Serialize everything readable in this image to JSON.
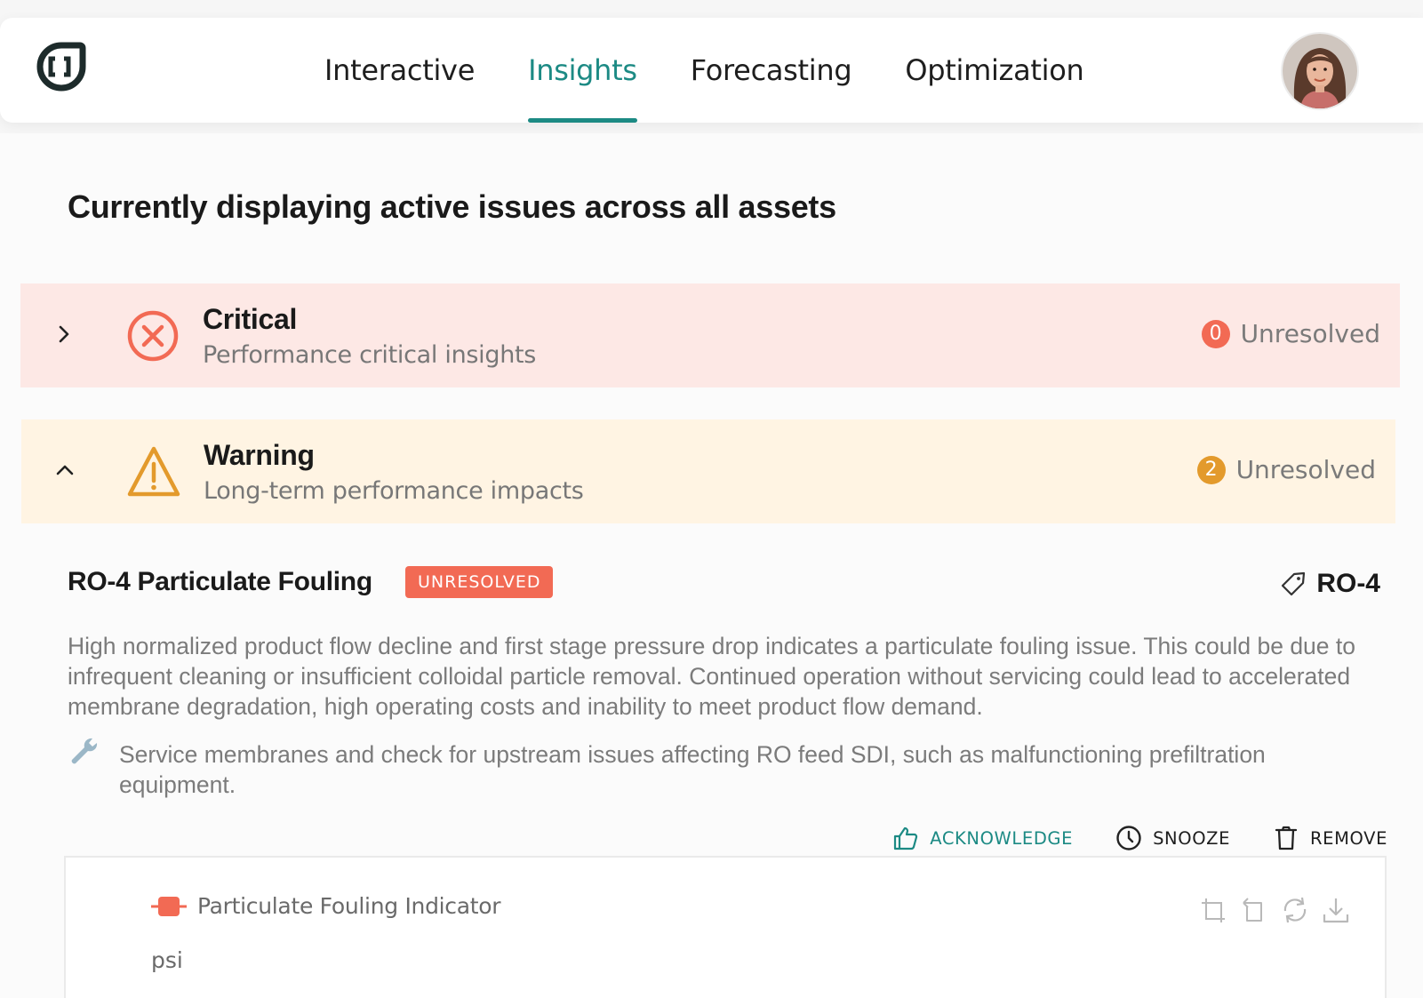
{
  "nav": {
    "items": [
      {
        "label": "Interactive",
        "active": false
      },
      {
        "label": "Insights",
        "active": true
      },
      {
        "label": "Forecasting",
        "active": false
      },
      {
        "label": "Optimization",
        "active": false
      }
    ]
  },
  "page": {
    "title": "Currently displaying active issues across all assets"
  },
  "severities": {
    "critical": {
      "title": "Critical",
      "subtitle": "Performance critical insights",
      "count": "0",
      "count_label": "Unresolved",
      "expanded": false
    },
    "warning": {
      "title": "Warning",
      "subtitle": "Long-term performance impacts",
      "count": "2",
      "count_label": "Unresolved",
      "expanded": true
    }
  },
  "issue": {
    "title": "RO-4 Particulate Fouling",
    "status": "UNRESOLVED",
    "asset": "RO-4",
    "description": "High normalized product flow decline and first stage pressure drop indicates a particulate fouling issue. This could be due to infrequent cleaning or insufficient colloidal particle removal. Continued operation without servicing could lead to accelerated membrane degradation, high operating costs and inability to meet product flow demand.",
    "recommendation": "Service membranes and check for upstream issues affecting RO feed SDI, such as malfunctioning prefiltration equipment.",
    "actions": {
      "acknowledge": "ACKNOWLEDGE",
      "snooze": "SNOOZE",
      "remove": "REMOVE"
    }
  },
  "chart": {
    "legend_label": "Particulate Fouling Indicator",
    "unit": "psi"
  },
  "colors": {
    "accent": "#1c8a84",
    "critical": "#f26a54",
    "critical_bg": "#fde8e5",
    "warning": "#e39a2c",
    "warning_bg": "#fff4e3"
  },
  "icons": [
    "logo-icon",
    "chevron-right-icon",
    "error-circle-icon",
    "chevron-up-icon",
    "warning-triangle-icon",
    "tag-icon",
    "wrench-icon",
    "thumbs-up-icon",
    "clock-icon",
    "trash-icon",
    "zoom-select-icon",
    "zoom-reset-icon",
    "refresh-icon",
    "download-icon"
  ]
}
